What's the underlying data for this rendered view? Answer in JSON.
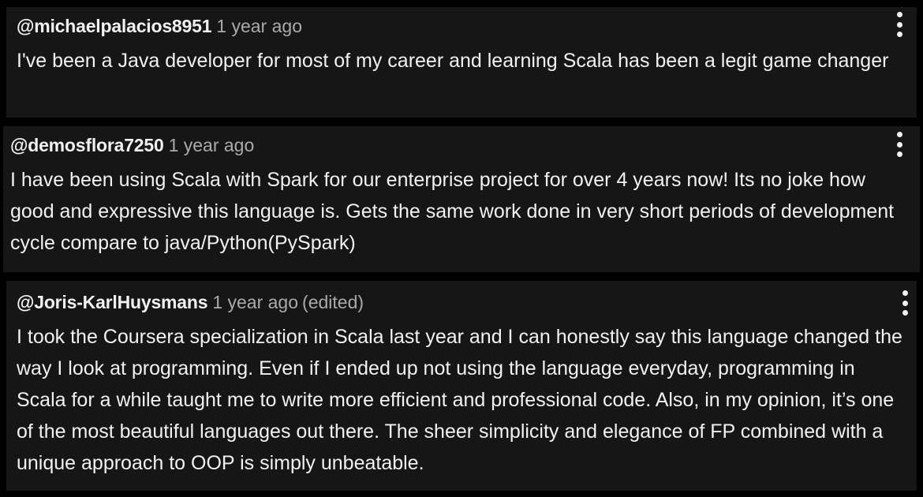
{
  "comments": [
    {
      "handle": "@michaelpalacios8951",
      "time": "1 year ago",
      "edited": "",
      "text": "I've been a Java developer for most of my career and learning Scala has been a legit game changer"
    },
    {
      "handle": "@demosflora7250",
      "time": "1 year ago",
      "edited": "",
      "text": "I have been using Scala with Spark for our enterprise project for over 4 years now! Its no joke how good and expressive this language is. Gets the same work done in very short periods of development cycle compare to java/Python(PySpark)"
    },
    {
      "handle": "@Joris-KarlHuysmans",
      "time": "1 year ago",
      "edited": "(edited)",
      "text": "I took the Coursera specialization in Scala last year and I can honestly say this language changed the way I look at programming. Even if I ended up not using the language everyday, programming in Scala for a while taught me to write more efficient and professional code. Also, in my opinion, it’s one of the most beautiful languages out there. The sheer simplicity and elegance of FP combined with a unique approach to OOP is simply unbeatable."
    }
  ],
  "icons": {
    "menu": "more-vertical-icon"
  },
  "colors": {
    "background": "#000000",
    "card": "#161616",
    "text": "#f1f1f1",
    "muted": "#aaaaaa"
  }
}
